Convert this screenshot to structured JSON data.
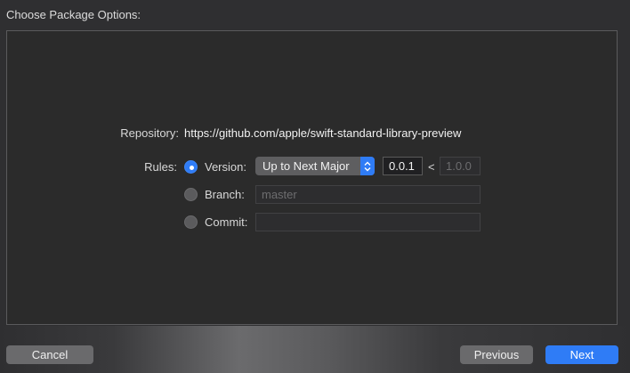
{
  "header": {
    "title": "Choose Package Options:"
  },
  "repository": {
    "label": "Repository:",
    "url": "https://github.com/apple/swift-standard-library-preview"
  },
  "rules": {
    "label": "Rules:",
    "version": {
      "label": "Version:",
      "selected": true,
      "rule": "Up to Next Major",
      "from": "0.0.1",
      "separator": "<",
      "to": "1.0.0"
    },
    "branch": {
      "label": "Branch:",
      "selected": false,
      "placeholder": "master"
    },
    "commit": {
      "label": "Commit:",
      "selected": false,
      "value": ""
    }
  },
  "buttons": {
    "cancel": "Cancel",
    "previous": "Previous",
    "next": "Next"
  },
  "colors": {
    "accent": "#2f7cf6",
    "background": "#2f2f31",
    "panel": "#2b2b2b"
  }
}
